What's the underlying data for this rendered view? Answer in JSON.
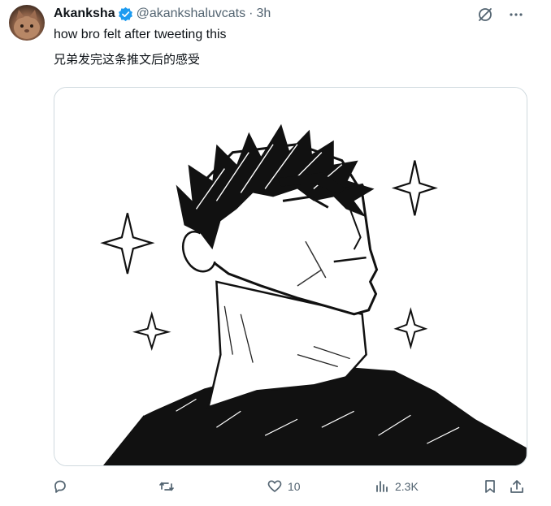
{
  "tweet": {
    "author": {
      "display_name": "Akanksha",
      "handle": "@akankshaluvcats",
      "verified": true,
      "avatar_icon": "cat-avatar"
    },
    "separator": "·",
    "time": "3h",
    "text_en": "how bro felt after tweeting this",
    "text_zh": "兄弟发完这条推文后的感受",
    "media": {
      "type": "image",
      "description_icon": "sketch-portrait-image"
    },
    "actions": {
      "reply": {
        "icon": "reply-icon",
        "count": ""
      },
      "retweet": {
        "icon": "retweet-icon",
        "count": ""
      },
      "like": {
        "icon": "heart-icon",
        "count": "10"
      },
      "views": {
        "icon": "views-icon",
        "count": "2.3K"
      },
      "bookmark": {
        "icon": "bookmark-icon"
      },
      "share": {
        "icon": "share-icon"
      }
    },
    "top_icons": [
      "grok-icon",
      "more-icon"
    ]
  },
  "colors": {
    "text_primary": "#0f1419",
    "text_secondary": "#536471",
    "verified_blue": "#1d9bf0",
    "border": "#cfd9de"
  }
}
